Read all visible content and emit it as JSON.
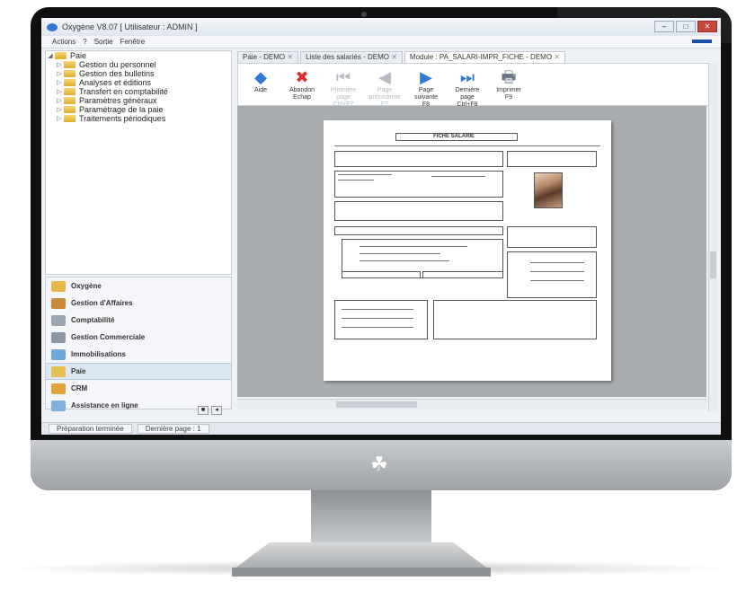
{
  "window": {
    "title": "Oxygène V8.07 [ Utilisateur : ADMIN ]",
    "controls": [
      "–",
      "□",
      "✕"
    ]
  },
  "menu": [
    "Actions",
    "?",
    "Sortie",
    "Fenêtre"
  ],
  "tree": {
    "root": "Paie",
    "items": [
      "Gestion du personnel",
      "Gestion des bulletins",
      "Analyses et éditions",
      "Transfert en comptabilité",
      "Paramètres généraux",
      "Paramétrage de la paie",
      "Traitements périodiques"
    ]
  },
  "modules": [
    {
      "label": "Oxygène",
      "icon": "folder-icon",
      "color": "#e8b84a"
    },
    {
      "label": "Gestion d'Affaires",
      "icon": "briefcase-icon",
      "color": "#c98a3c"
    },
    {
      "label": "Comptabilité",
      "icon": "ledger-icon",
      "color": "#9aa6b4"
    },
    {
      "label": "Gestion Commerciale",
      "icon": "cash-register-icon",
      "color": "#8d98a6"
    },
    {
      "label": "Immobilisations",
      "icon": "building-icon",
      "color": "#6fa7d9"
    },
    {
      "label": "Paie",
      "icon": "coins-icon",
      "color": "#e6c04f"
    },
    {
      "label": "CRM",
      "icon": "contacts-icon",
      "color": "#e3a33b"
    },
    {
      "label": "Assistance en ligne",
      "icon": "help-icon",
      "color": "#7fb0e0"
    }
  ],
  "active_module": "Paie",
  "tabs": [
    {
      "label": "Paie - DEMO",
      "active": false
    },
    {
      "label": "Liste des salariés - DEMO",
      "active": false
    },
    {
      "label": "Module : PA_SALARI-IMPR_FICHE - DEMO",
      "active": true
    }
  ],
  "toolbar": [
    {
      "label": "Aide",
      "icon": "help-icon",
      "glyph": "◆",
      "color": "#2f7bd3",
      "disabled": false
    },
    {
      "label": "Abandon\nEchap",
      "icon": "cancel-icon",
      "glyph": "✖",
      "color": "#d9302a",
      "disabled": false
    },
    {
      "label": "Première\npage\nCtrl+F7",
      "icon": "first-page-icon",
      "glyph": "⏮",
      "color": "#b6bcc5",
      "disabled": true
    },
    {
      "label": "Page\nprécédente\nF7",
      "icon": "previous-page-icon",
      "glyph": "◀",
      "color": "#b6bcc5",
      "disabled": true
    },
    {
      "label": "Page\nsuivante\nF8",
      "icon": "next-page-icon",
      "glyph": "▶",
      "color": "#2f7bd3",
      "disabled": false
    },
    {
      "label": "Dernière\npage\nCtrl+F8",
      "icon": "last-page-icon",
      "glyph": "⏭",
      "color": "#2f7bd3",
      "disabled": false
    },
    {
      "label": "Imprimer\nF9",
      "icon": "printer-icon",
      "glyph": "🖶",
      "color": "#6a7685",
      "disabled": false
    }
  ],
  "document": {
    "heading": "FICHE SALARIE"
  },
  "statusbar": [
    "Préparation terminée",
    "Dernière page : 1"
  ]
}
